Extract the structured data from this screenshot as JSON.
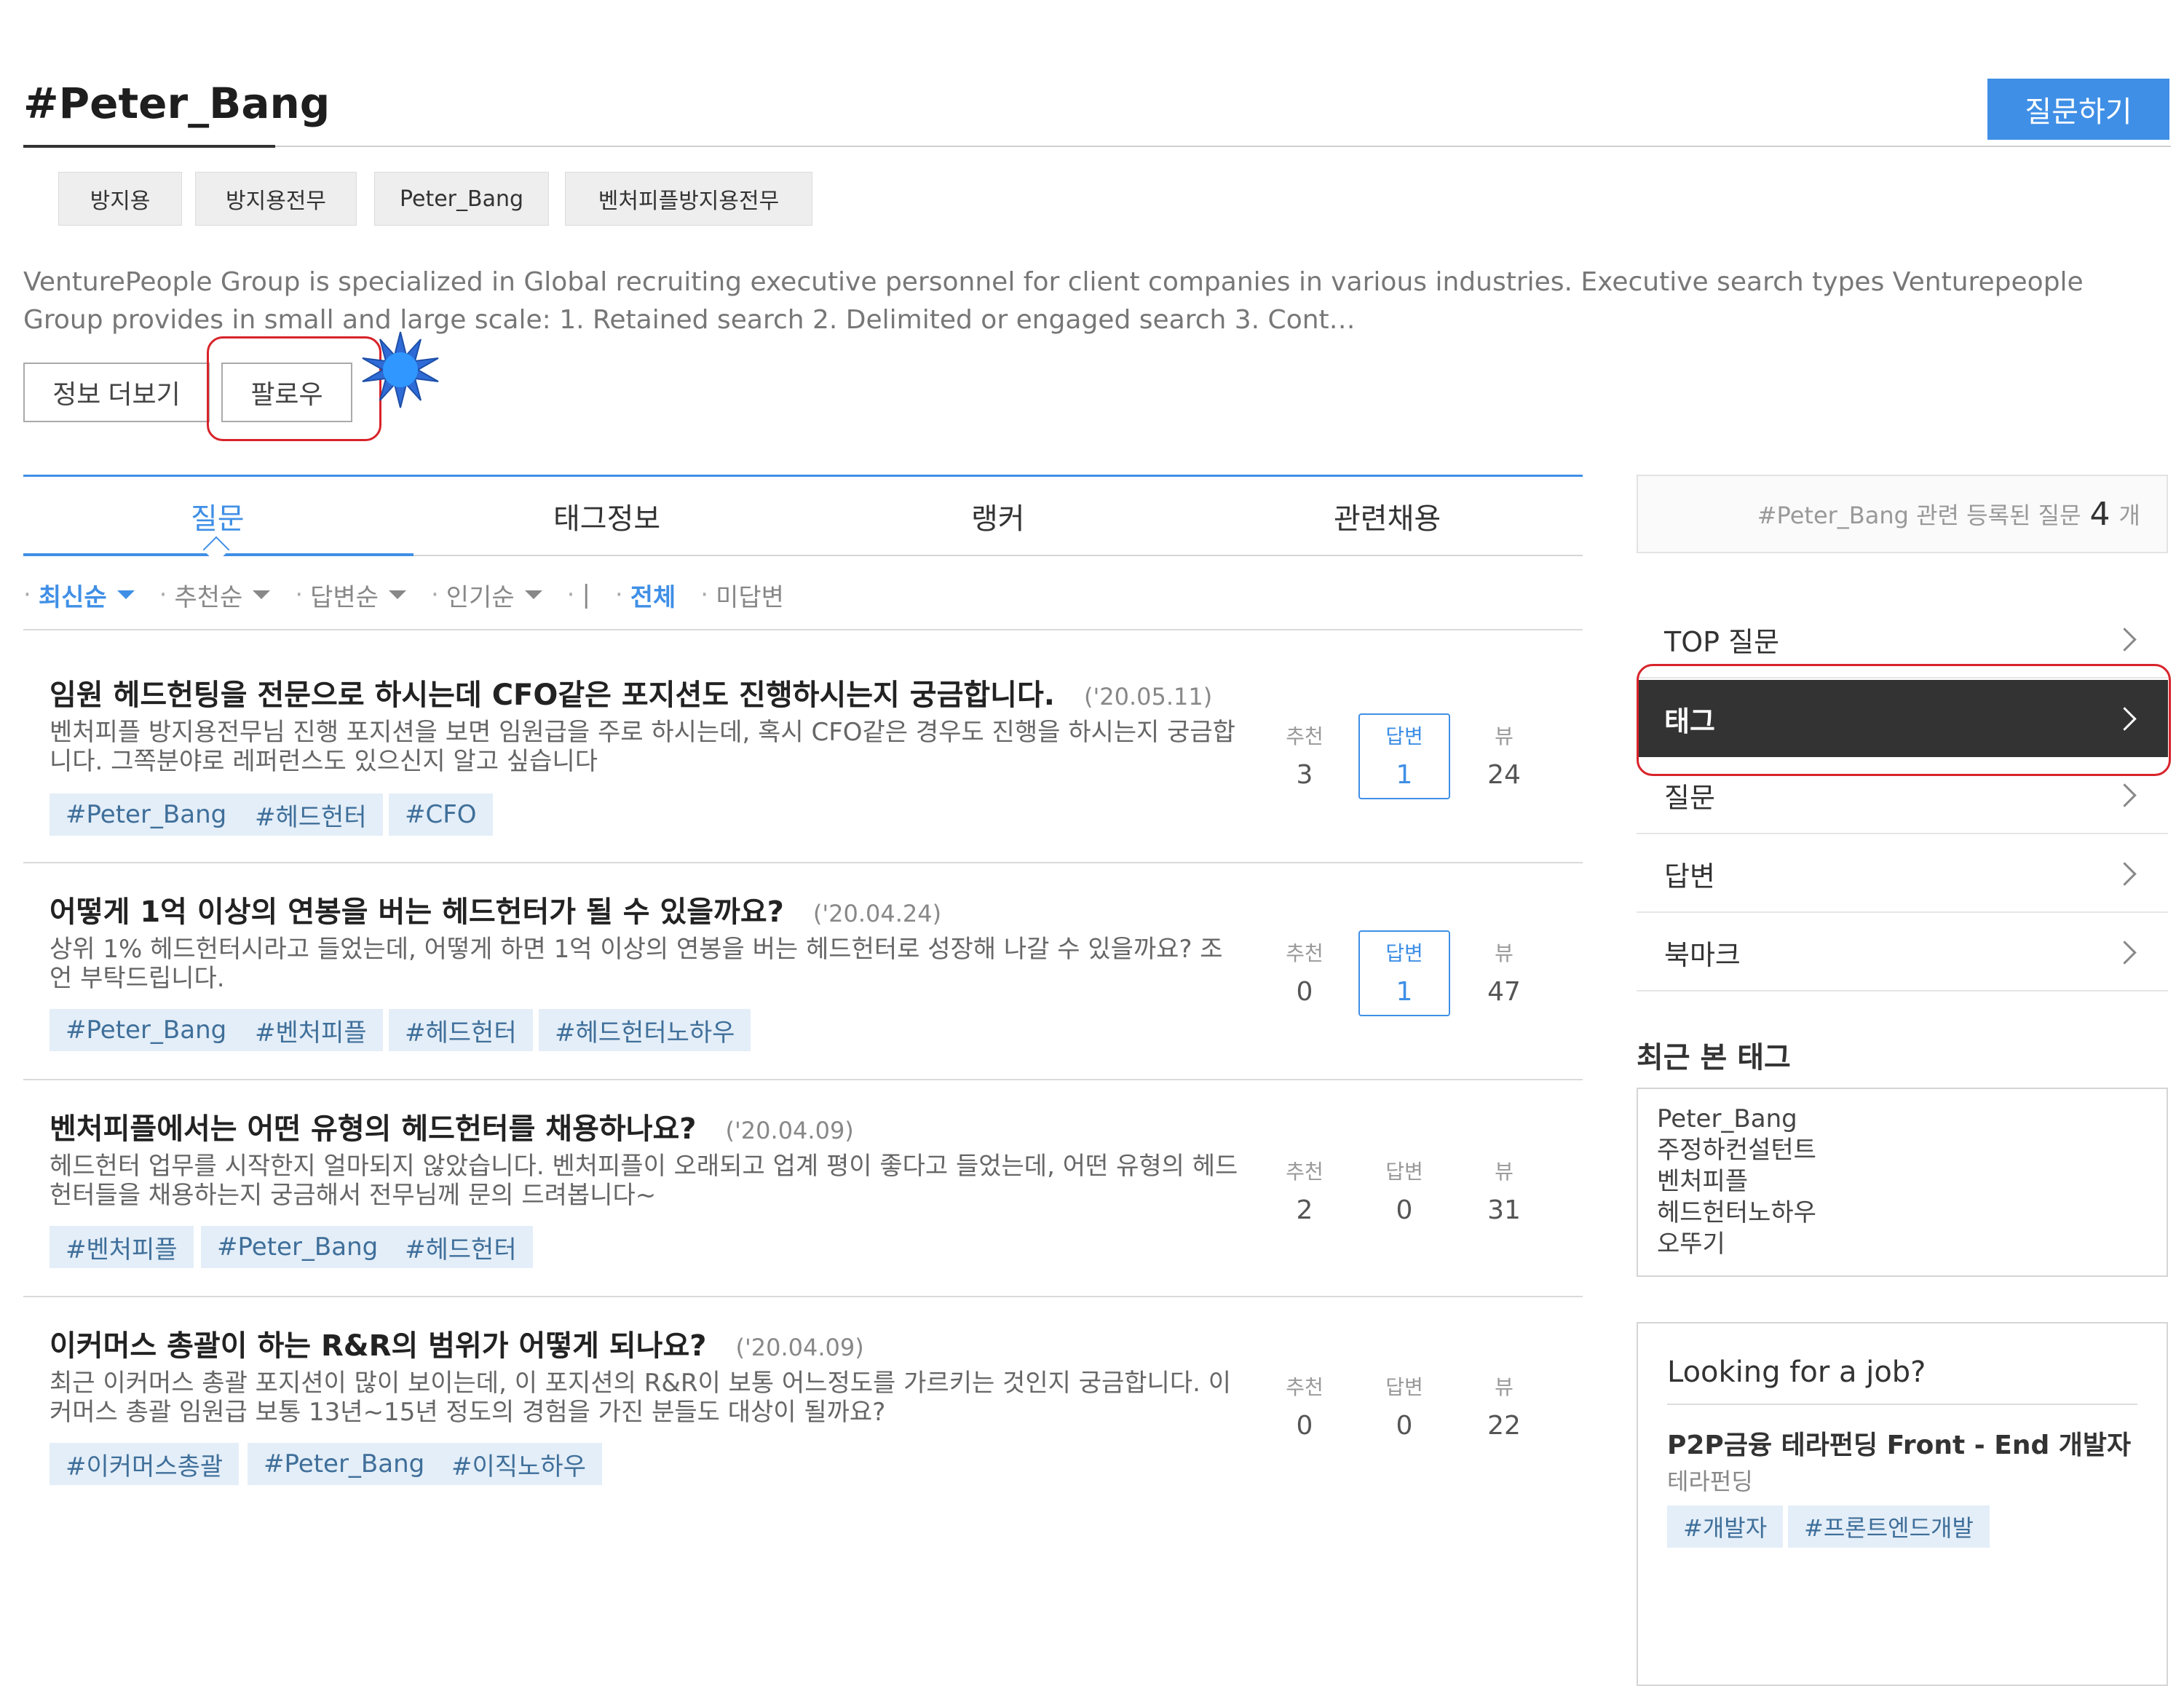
{
  "header": {
    "title": "#Peter_Bang",
    "ask_button": "질문하기"
  },
  "keywords": [
    "방지용",
    "방지용전무",
    "Peter_Bang",
    "벤처피플방지용전무"
  ],
  "description": "VenturePeople Group is specialized in Global recruiting executive personnel for client companies in various industries. Executive search types Venturepeople Group provides in small and large scale: 1. Retained search 2. Delimited or engaged search 3. Cont…",
  "actions": {
    "more_info": "정보 더보기",
    "follow": "팔로우"
  },
  "tabs": [
    {
      "label": "질문",
      "active": true
    },
    {
      "label": "태그정보",
      "active": false
    },
    {
      "label": "랭커",
      "active": false
    },
    {
      "label": "관련채용",
      "active": false
    }
  ],
  "sort": {
    "latest": "최신순",
    "recommended": "추천순",
    "answers": "답변순",
    "popular": "인기순",
    "divider": "|",
    "all": "전체",
    "unanswered": "미답변"
  },
  "stat_labels": {
    "recommend": "추천",
    "answer": "답변",
    "view": "뷰"
  },
  "questions": [
    {
      "title": "임원 헤드헌팅을 전문으로 하시는데 CFO같은 포지션도 진행하시는지 궁금합니다.",
      "date": "('20.05.11)",
      "body": "벤처피플 방지용전무님 진행 포지션을 보면 임원급을 주로 하시는데, 혹시 CFO같은 경우도 진행을 하시는지 궁금합니다. 그쪽분야로 레퍼런스도 있으신지 알고 싶습니다",
      "tags": [
        "#Peter_Bang",
        "#헤드헌터",
        "#CFO"
      ],
      "recommend": "3",
      "answers": "1",
      "views": "24",
      "answered": true
    },
    {
      "title": "어떻게 1억 이상의 연봉을 버는 헤드헌터가 될 수 있을까요?",
      "date": "('20.04.24)",
      "body": "상위 1% 헤드헌터시라고 들었는데, 어떻게 하면 1억 이상의 연봉을 버는 헤드헌터로 성장해 나갈 수 있을까요? 조언 부탁드립니다.",
      "tags": [
        "#Peter_Bang",
        "#벤처피플",
        "#헤드헌터",
        "#헤드헌터노하우"
      ],
      "recommend": "0",
      "answers": "1",
      "views": "47",
      "answered": true
    },
    {
      "title": "벤처피플에서는 어떤 유형의 헤드헌터를 채용하나요?",
      "date": "('20.04.09)",
      "body": "헤드헌터 업무를 시작한지 얼마되지 않았습니다. 벤처피플이 오래되고 업계 평이 좋다고 들었는데, 어떤 유형의 헤드헌터들을 채용하는지 궁금해서 전무님께 문의 드려봅니다~",
      "tags": [
        "#벤처피플",
        "#Peter_Bang",
        "#헤드헌터"
      ],
      "recommend": "2",
      "answers": "0",
      "views": "31",
      "answered": false
    },
    {
      "title": "이커머스 총괄이 하는 R&R의 범위가 어떻게 되나요?",
      "date": "('20.04.09)",
      "body": "최근 이커머스 총괄 포지션이 많이 보이는데, 이 포지션의 R&R이 보통 어느정도를 가르키는 것인지 궁금합니다. 이커머스 총괄 임원급 보통 13년~15년 정도의 경험을 가진 분들도 대상이 될까요?",
      "tags": [
        "#이커머스총괄",
        "#Peter_Bang",
        "#이직노하우"
      ],
      "recommend": "0",
      "answers": "0",
      "views": "22",
      "answered": false
    }
  ],
  "sidebar": {
    "count_prefix": "#Peter_Bang 관련 등록된 질문",
    "count": "4",
    "count_unit": "개",
    "menu": [
      {
        "label": "TOP 질문",
        "active": false
      },
      {
        "label": "태그",
        "active": true
      },
      {
        "label": "질문",
        "active": false
      },
      {
        "label": "답변",
        "active": false
      },
      {
        "label": "북마크",
        "active": false
      }
    ],
    "recent_heading": "최근 본 태그",
    "recent_tags": [
      "Peter_Bang",
      "주정하컨설턴트",
      "벤처피플",
      "헤드헌터노하우",
      "오뚜기"
    ],
    "job": {
      "heading": "Looking for a job?",
      "title": "P2P금융 테라펀딩 Front - End 개발자",
      "company": "테라펀딩",
      "tags": [
        "#개발자",
        "#프론트엔드개발"
      ]
    }
  },
  "colors": {
    "accent": "#3f8fe6",
    "highlight": "#d8232a",
    "active_menu_bg": "#333333",
    "tag_bg": "#e4eef8"
  }
}
